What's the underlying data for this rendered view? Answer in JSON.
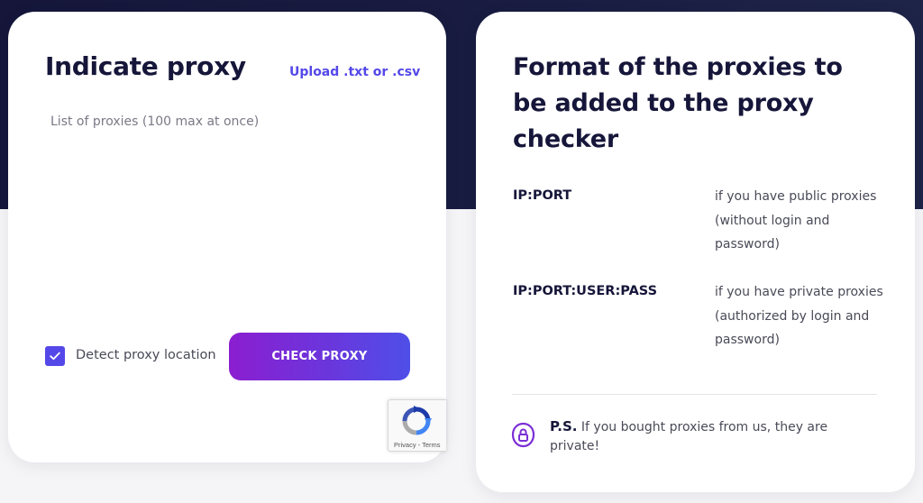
{
  "left_card": {
    "title": "Indicate proxy",
    "upload_link": "Upload .txt or .csv",
    "proxy_list": {
      "value": "",
      "placeholder": "List of proxies (100 max at once)"
    },
    "detect_location": {
      "label": "Detect proxy location",
      "checked": true
    },
    "check_button": "CHECK PROXY",
    "recaptcha": {
      "footer": "Privacy - Terms"
    }
  },
  "right_card": {
    "title": "Format of the proxies to be added to the proxy checker",
    "formats": [
      {
        "code": "IP:PORT",
        "description": "if you have public proxies (without login and password)"
      },
      {
        "code": "IP:PORT:USER:PASS",
        "description": "if you have private proxies (authorized by login and password)"
      }
    ],
    "note": {
      "label": "P.S.",
      "text": "If you bought proxies from us, they are private!"
    }
  },
  "colors": {
    "accent": "#5548e8",
    "button_gradient_start": "#8b1ed0",
    "button_gradient_end": "#4f4fe8",
    "dark_header": "#15163a",
    "icon_purple": "#7b2fd6"
  },
  "icons": {
    "checkbox": "checkmark-icon",
    "recaptcha": "recaptcha-logo-icon",
    "note": "user-lock-icon"
  }
}
